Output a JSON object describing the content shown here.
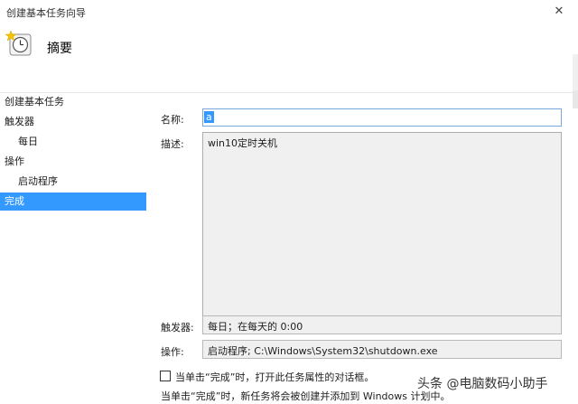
{
  "window": {
    "title": "创建基本任务向导",
    "close_glyph": "✕"
  },
  "header": {
    "title": "摘要",
    "icon": "clock-task-icon"
  },
  "sidebar": {
    "items": [
      {
        "label": "创建基本任务"
      },
      {
        "label": "触发器"
      },
      {
        "label": "每日"
      },
      {
        "label": "操作"
      },
      {
        "label": "启动程序"
      },
      {
        "label": "完成"
      }
    ]
  },
  "form": {
    "name_label": "名称:",
    "name_value": "a",
    "description_label": "描述:",
    "description_value": "win10定时关机",
    "trigger_label": "触发器:",
    "trigger_value": "每日；在每天的 0:00",
    "action_label": "操作:",
    "action_value": "启动程序; C:\\Windows\\System32\\shutdown.exe"
  },
  "checkbox": {
    "label": "当单击“完成”时，打开此任务属性的对话框。",
    "checked": false
  },
  "footer_note": "当单击“完成”时，新任务将会被创建并添加到 Windows 计划中。",
  "watermark": "头条 @电脑数码小助手",
  "colors": {
    "selection": "#3399ff",
    "readonly_bg": "#f0f0f0",
    "focus_border": "#7aa7d9"
  }
}
